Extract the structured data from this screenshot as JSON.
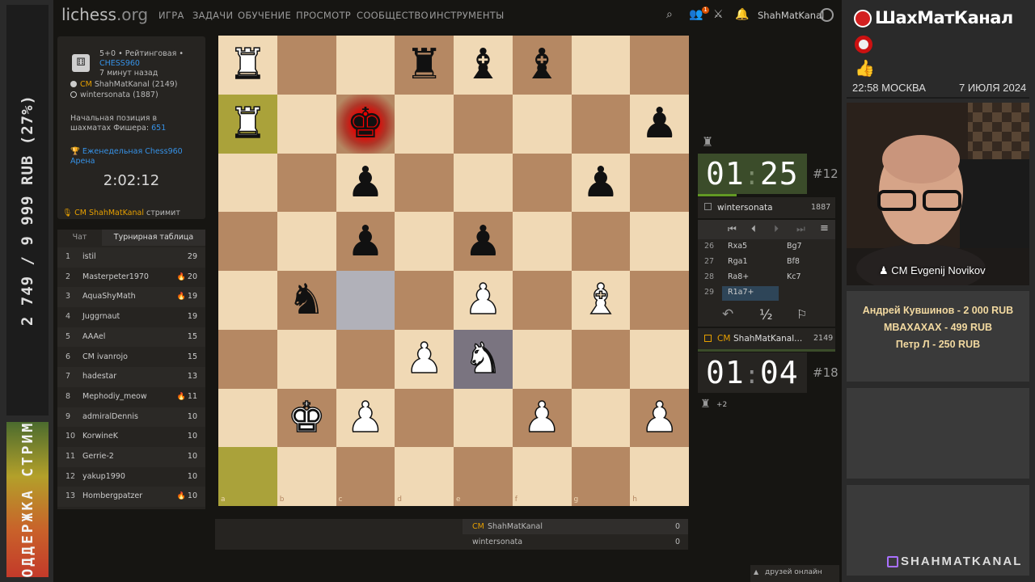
{
  "stream_left": {
    "goal_text": "2 749 / 9 999 RUB (27%)",
    "support_text": "ПОДДЕРЖКА СТРИМА"
  },
  "lichess": {
    "logo": "lichess",
    "logo_tld": ".org",
    "nav": [
      "ИГРА",
      "ЗАДАЧИ",
      "ОБУЧЕНИЕ",
      "ПРОСМОТР",
      "СООБЩЕСТВО",
      "ИНСТРУМЕНТЫ"
    ],
    "notification_count": "1",
    "username": "ShahMatKanal",
    "game": {
      "time_control": "5+0 • Рейтинговая •",
      "variant": "CHESS960",
      "ago": "7 минут назад",
      "white_title": "CM",
      "white_name": "ShahMatKanal",
      "white_rating": "(2149)",
      "black_name": "wintersonata (1887)",
      "position_label": "Начальная позиция в шахматах Фишера:",
      "position_number": "651",
      "tournament": "Еженедельная Chess960 Арена",
      "tournament_clock": "2:02:12",
      "streamer_title": "CM",
      "streamer_name": "ShahMatKanal",
      "streamer_suffix": "стримит"
    },
    "tabs": {
      "chat": "Чат",
      "standings": "Турнирная таблица"
    },
    "standings": [
      {
        "rank": "1",
        "name": "istil",
        "score": "29",
        "fire": false
      },
      {
        "rank": "2",
        "name": "Masterpeter1970",
        "score": "20",
        "fire": true
      },
      {
        "rank": "3",
        "name": "AquaShyMath",
        "score": "19",
        "fire": true
      },
      {
        "rank": "4",
        "name": "Juggrnaut",
        "score": "19",
        "fire": false
      },
      {
        "rank": "5",
        "name": "AAAel",
        "score": "15",
        "fire": false
      },
      {
        "rank": "6",
        "name": "CM ivanrojo",
        "score": "15",
        "fire": false
      },
      {
        "rank": "7",
        "name": "hadestar",
        "score": "13",
        "fire": false
      },
      {
        "rank": "8",
        "name": "Mephodiy_meow",
        "score": "11",
        "fire": true
      },
      {
        "rank": "9",
        "name": "admiralDennis",
        "score": "10",
        "fire": false
      },
      {
        "rank": "10",
        "name": "KorwineK",
        "score": "10",
        "fire": false
      },
      {
        "rank": "11",
        "name": "Gerrie-2",
        "score": "10",
        "fire": false
      },
      {
        "rank": "12",
        "name": "yakup1990",
        "score": "10",
        "fire": false
      },
      {
        "rank": "13",
        "name": "Hombergpatzer",
        "score": "10",
        "fire": true
      }
    ],
    "board": {
      "files": [
        "a",
        "b",
        "c",
        "d",
        "e",
        "f",
        "g",
        "h"
      ],
      "ranks": [
        "8",
        "7",
        "6",
        "5",
        "4",
        "3",
        "2",
        "1"
      ],
      "pieces": [
        {
          "sq": "a8",
          "glyph": "♜",
          "color": "w"
        },
        {
          "sq": "d8",
          "glyph": "♜",
          "color": "b"
        },
        {
          "sq": "e8",
          "glyph": "♝",
          "color": "b"
        },
        {
          "sq": "f8",
          "glyph": "♝",
          "color": "b"
        },
        {
          "sq": "a7",
          "glyph": "♜",
          "color": "w"
        },
        {
          "sq": "c7",
          "glyph": "♚",
          "color": "b"
        },
        {
          "sq": "h7",
          "glyph": "♟",
          "color": "b"
        },
        {
          "sq": "c6",
          "glyph": "♟",
          "color": "b"
        },
        {
          "sq": "g6",
          "glyph": "♟",
          "color": "b"
        },
        {
          "sq": "c5",
          "glyph": "♟",
          "color": "b"
        },
        {
          "sq": "e5",
          "glyph": "♟",
          "color": "b"
        },
        {
          "sq": "b4",
          "glyph": "♞",
          "color": "b"
        },
        {
          "sq": "e4",
          "glyph": "♟",
          "color": "w"
        },
        {
          "sq": "g4",
          "glyph": "♝",
          "color": "w"
        },
        {
          "sq": "d3",
          "glyph": "♟",
          "color": "w"
        },
        {
          "sq": "e3",
          "glyph": "♞",
          "color": "w"
        },
        {
          "sq": "b2",
          "glyph": "♚",
          "color": "w"
        },
        {
          "sq": "c2",
          "glyph": "♟",
          "color": "w"
        },
        {
          "sq": "f2",
          "glyph": "♟",
          "color": "w"
        },
        {
          "sq": "h2",
          "glyph": "♟",
          "color": "w"
        }
      ],
      "last_move_squares": [
        "a7",
        "a1"
      ],
      "check_square": "c7",
      "highlight_squares": [
        "c4",
        "e3"
      ]
    },
    "opponent": {
      "clock_min": "01",
      "clock_sec": "25",
      "rank": "#12",
      "name": "wintersonata",
      "rating": "1887"
    },
    "player": {
      "clock_min": "01",
      "clock_sec": "04",
      "rank": "#18",
      "title": "CM",
      "name": "ShahMatKanal...",
      "rating": "2149",
      "material": "+2"
    },
    "moves": [
      {
        "n": "26",
        "w": "Rxa5",
        "b": "Bg7"
      },
      {
        "n": "27",
        "w": "Rga1",
        "b": "Bf8"
      },
      {
        "n": "28",
        "w": "Ra8+",
        "b": "Kc7"
      },
      {
        "n": "29",
        "w": "R1a7+",
        "b": ""
      }
    ],
    "controls": {
      "draw": "½"
    },
    "scores": [
      {
        "title": "CM",
        "name": "ShahMatKanal",
        "score": "0"
      },
      {
        "title": "",
        "name": "wintersonata",
        "score": "0"
      }
    ],
    "friends_online": "друзей онлайн"
  },
  "stream_right": {
    "brand": "ШахМатКанал",
    "time": "22:58 МОСКВА",
    "date": "7 ИЮЛЯ 2024",
    "cam_name": "CM Evgenij Novikov",
    "donations": [
      "Андрей Кувшинов - 2 000 RUB",
      "MBAXAXAX - 499 RUB",
      "Петр Л - 250 RUB"
    ],
    "twitch": "SHAHMATKANAL"
  },
  "colors": {
    "light_sq": "#f0d9b5",
    "dark_sq": "#b58863",
    "accent_blue": "#3692e7",
    "clock_active": "#2e4b23"
  }
}
